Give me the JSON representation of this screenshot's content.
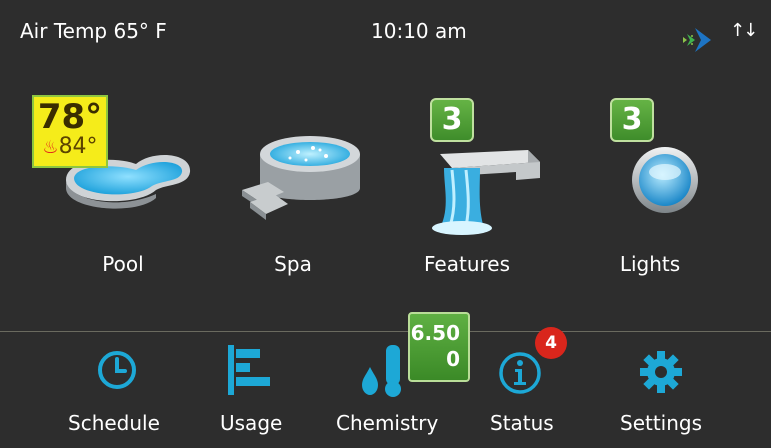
{
  "header": {
    "air_temp": "Air Temp 65° F",
    "time": "10:10 am",
    "logo_icon": "pentair-logo-icon",
    "signal_icon": "up-down-arrows-icon",
    "signal_text": "↑↓"
  },
  "tiles": {
    "pool": {
      "label": "Pool",
      "temp": "78°",
      "setpoint": "84°",
      "flame": "🔥"
    },
    "spa": {
      "label": "Spa"
    },
    "features": {
      "label": "Features",
      "count": "3"
    },
    "lights": {
      "label": "Lights",
      "count": "3"
    }
  },
  "nav": {
    "schedule": {
      "label": "Schedule",
      "icon": "clock-icon"
    },
    "usage": {
      "label": "Usage",
      "icon": "bar-chart-icon"
    },
    "chemistry": {
      "label": "Chemistry",
      "icon": "thermometer-drop-icon",
      "value1": "6.50",
      "value2": "0"
    },
    "status": {
      "label": "Status",
      "icon": "info-icon",
      "alerts": "4"
    },
    "settings": {
      "label": "Settings",
      "icon": "gear-icon"
    }
  },
  "colors": {
    "background": "#2d2d2d",
    "accent": "#1da8d6",
    "badge_green": "#4a9c32",
    "badge_yellow": "#f5ec1a",
    "alert_red": "#d9261c"
  }
}
